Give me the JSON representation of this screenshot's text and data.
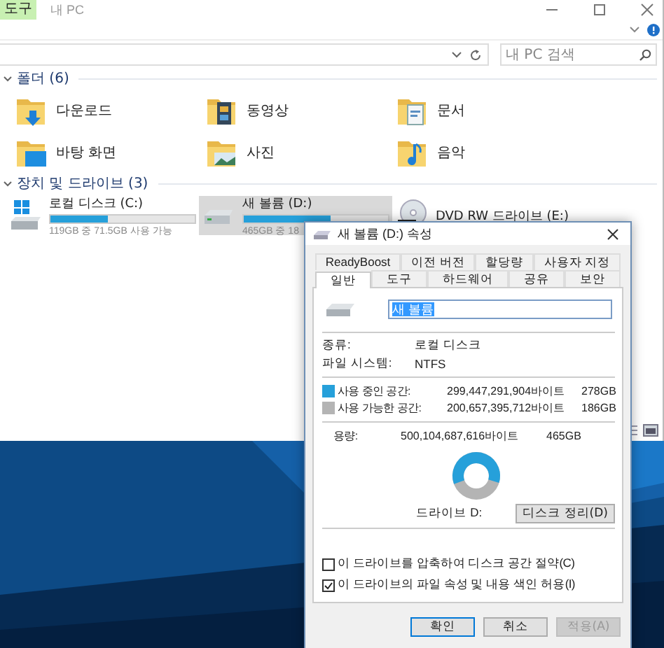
{
  "window": {
    "ribbon_tab": "도구",
    "title": "내 PC"
  },
  "search": {
    "placeholder": "내 PC 검색"
  },
  "groups": [
    {
      "title": "폴더 (6)",
      "expanded": true,
      "items": [
        {
          "kind": "downloads",
          "label": "다운로드"
        },
        {
          "kind": "videos",
          "label": "동영상"
        },
        {
          "kind": "documents",
          "label": "문서"
        },
        {
          "kind": "desktop",
          "label": "바탕 화면"
        },
        {
          "kind": "pictures",
          "label": "사진"
        },
        {
          "kind": "music",
          "label": "음악"
        }
      ]
    },
    {
      "title": "장치 및 드라이브 (3)",
      "expanded": true,
      "drives": [
        {
          "kind": "system",
          "label": "로컬 디스크 (C:)",
          "detail": "119GB 중 71.5GB 사용 가능",
          "level": 0.4,
          "selected": false
        },
        {
          "kind": "disk",
          "label": "새 볼륨 (D:)",
          "detail": "465GB 중 18",
          "level": 0.6,
          "selected": true
        },
        {
          "kind": "dvd",
          "label": "DVD RW 드라이브 (E:)",
          "selected": false
        }
      ]
    }
  ],
  "dialog": {
    "title": "새 볼륨 (D:) 속성",
    "tab_rows": [
      {
        "tabs": [
          {
            "label": "ReadyBoost",
            "selected": false
          },
          {
            "label": "이전 버전",
            "selected": false
          },
          {
            "label": "할당량",
            "selected": false
          },
          {
            "label": "사용자 지정",
            "selected": false
          }
        ]
      },
      {
        "tabs": [
          {
            "label": "일반",
            "selected": true
          },
          {
            "label": "도구",
            "selected": false
          },
          {
            "label": "하드웨어",
            "selected": false
          },
          {
            "label": "공유",
            "selected": false
          },
          {
            "label": "보안",
            "selected": false
          }
        ]
      }
    ],
    "name_field": {
      "value": "새 볼륨"
    },
    "info": [
      {
        "label": "종류:",
        "value": "로컬 디스크"
      },
      {
        "label": "파일 시스템:",
        "value": "NTFS"
      }
    ],
    "space": [
      {
        "label": "사용 중인 공간:",
        "bytes": "299,447,291,904바이트",
        "size": "278GB",
        "color": "#26a0da"
      },
      {
        "label": "사용 가능한 공간:",
        "bytes": "200,657,395,712바이트",
        "size": "186GB",
        "color": "#b4b4b4"
      }
    ],
    "capacity": {
      "label": "용량:",
      "bytes": "500,104,687,616바이트",
      "size": "465GB"
    },
    "usage_chart": {
      "level": 0.6
    },
    "drive_label": "드라이브 D:",
    "cleanup_button": "디스크 정리(D)",
    "options": [
      {
        "label": "이 드라이브를 압축하여 디스크 공간 절약(C)",
        "checked": false
      },
      {
        "label": "이 드라이브의 파일 속성 및 내용 색인 허용(I)",
        "checked": true
      }
    ],
    "buttons": [
      {
        "label": "확인",
        "kind": "default",
        "disabled": false
      },
      {
        "label": "취소",
        "kind": "normal",
        "disabled": false
      },
      {
        "label": "적용(A)",
        "kind": "normal",
        "disabled": true
      }
    ]
  }
}
